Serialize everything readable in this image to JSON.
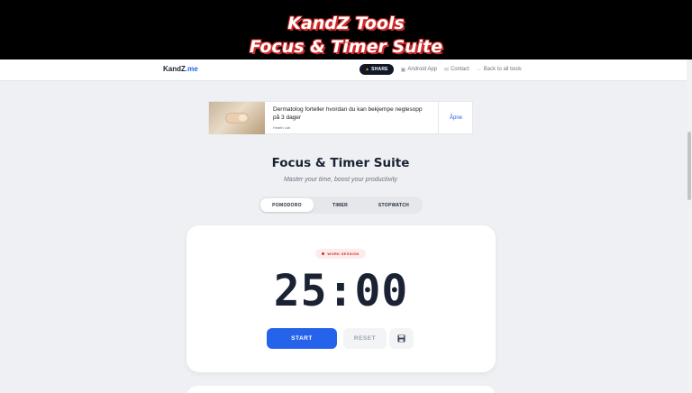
{
  "banner": {
    "line1": "KandZ Tools",
    "line2": "Focus & Timer Suite"
  },
  "nav": {
    "logo_main": "KandZ",
    "logo_accent": ".me",
    "share_label": "SHARE",
    "android_label": "Android App",
    "contact_label": "Contact",
    "back_label": "Back to all tools",
    "icons": [
      "share-icon",
      "android-icon",
      "mail-icon",
      "back-arrow-icon"
    ]
  },
  "ad": {
    "title": "Dermatolog forteller hvordan du kan bekjempe neglesopp på 3 dager",
    "source": "Health Lab",
    "cta": "Åpne"
  },
  "page": {
    "title": "Focus & Timer Suite",
    "subtitle": "Master your time, boost your productivity"
  },
  "tabs": [
    {
      "label": "POMODORO",
      "active": true
    },
    {
      "label": "TIMER",
      "active": false
    },
    {
      "label": "STOPWATCH",
      "active": false
    }
  ],
  "timer": {
    "session_label": "WORK SESSION",
    "display": "25:00",
    "start_label": "START",
    "reset_label": "RESET",
    "save_icon": "save-icon"
  },
  "colors": {
    "accent": "#2563eb",
    "session": "#dc2626",
    "banner_shadow": "#d12a2a",
    "text_dark": "#1a2233"
  }
}
